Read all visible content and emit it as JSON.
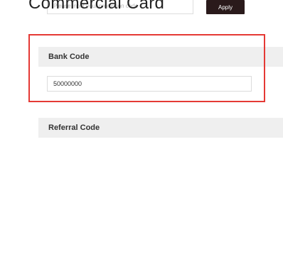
{
  "overlay_title": "Commercial Card",
  "promotion": {
    "placeholder": "Please input your promotion code",
    "apply_label": "Apply"
  },
  "bank_code": {
    "label": "Bank Code",
    "value": "50000000"
  },
  "referral_code": {
    "label": "Referral Code"
  },
  "colors": {
    "highlight": "#e53935",
    "apply_button": "#2a1a1b",
    "section_background": "#efefef"
  }
}
